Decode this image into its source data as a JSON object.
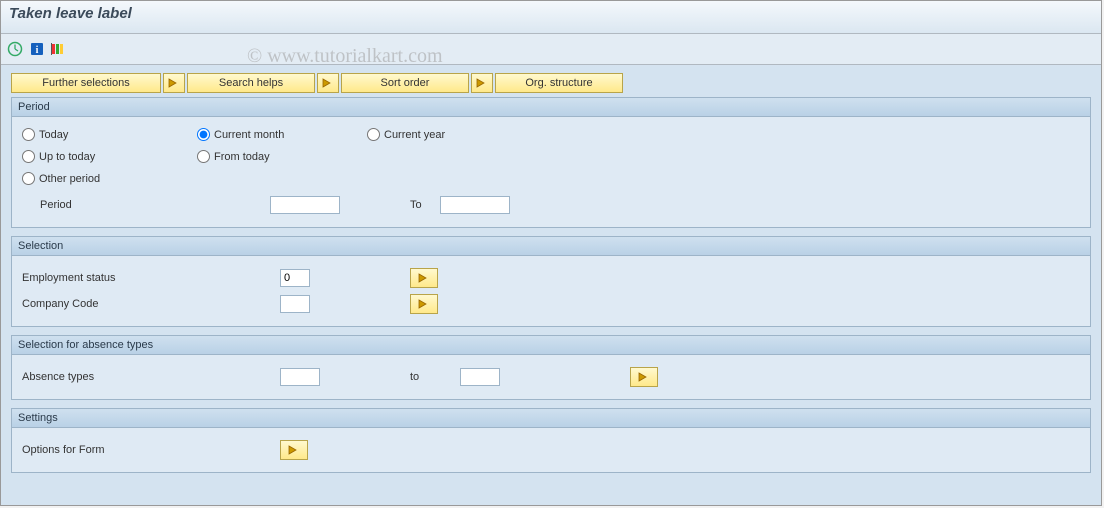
{
  "title": "Taken leave label",
  "watermark": "© www.tutorialkart.com",
  "toolbar_icons": {
    "execute": "execute-icon",
    "info": "info-icon",
    "variant": "variant-icon"
  },
  "buttons": {
    "further_selections": "Further selections",
    "search_helps": "Search helps",
    "sort_order": "Sort order",
    "org_structure": "Org. structure"
  },
  "group_period": {
    "title": "Period",
    "today": "Today",
    "current_month": "Current month",
    "current_year": "Current year",
    "up_to_today": "Up to today",
    "from_today": "From today",
    "other_period": "Other period",
    "period_label": "Period",
    "to_label": "To",
    "period_from": "",
    "period_to": "",
    "selected": "current_month"
  },
  "group_selection": {
    "title": "Selection",
    "emp_status_label": "Employment status",
    "emp_status_value": "0",
    "company_code_label": "Company Code",
    "company_code_value": ""
  },
  "group_absence": {
    "title": "Selection for absence types",
    "absence_types_label": "Absence types",
    "absence_from": "",
    "to_label": "to",
    "absence_to": ""
  },
  "group_settings": {
    "title": "Settings",
    "options_form_label": "Options for Form"
  }
}
